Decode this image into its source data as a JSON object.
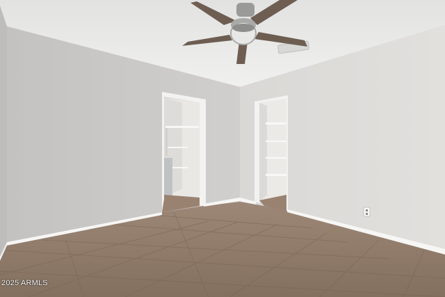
{
  "photo": {
    "watermark": "2025 ARMLS"
  },
  "colors": {
    "ceiling": "#ececeb",
    "wall_left": "#c9c8c6",
    "wall_center": "#d6d5d2",
    "wall_right": "#dcdbd8",
    "floor_tile": "#8f7868",
    "grout": "#7a6556",
    "baseboard": "#f6f6f4",
    "trim": "#f2f2f0",
    "closet_interior": "#e9e8e5",
    "fan_metal": "#9a9a98",
    "fan_blade": "#6e5e52"
  }
}
